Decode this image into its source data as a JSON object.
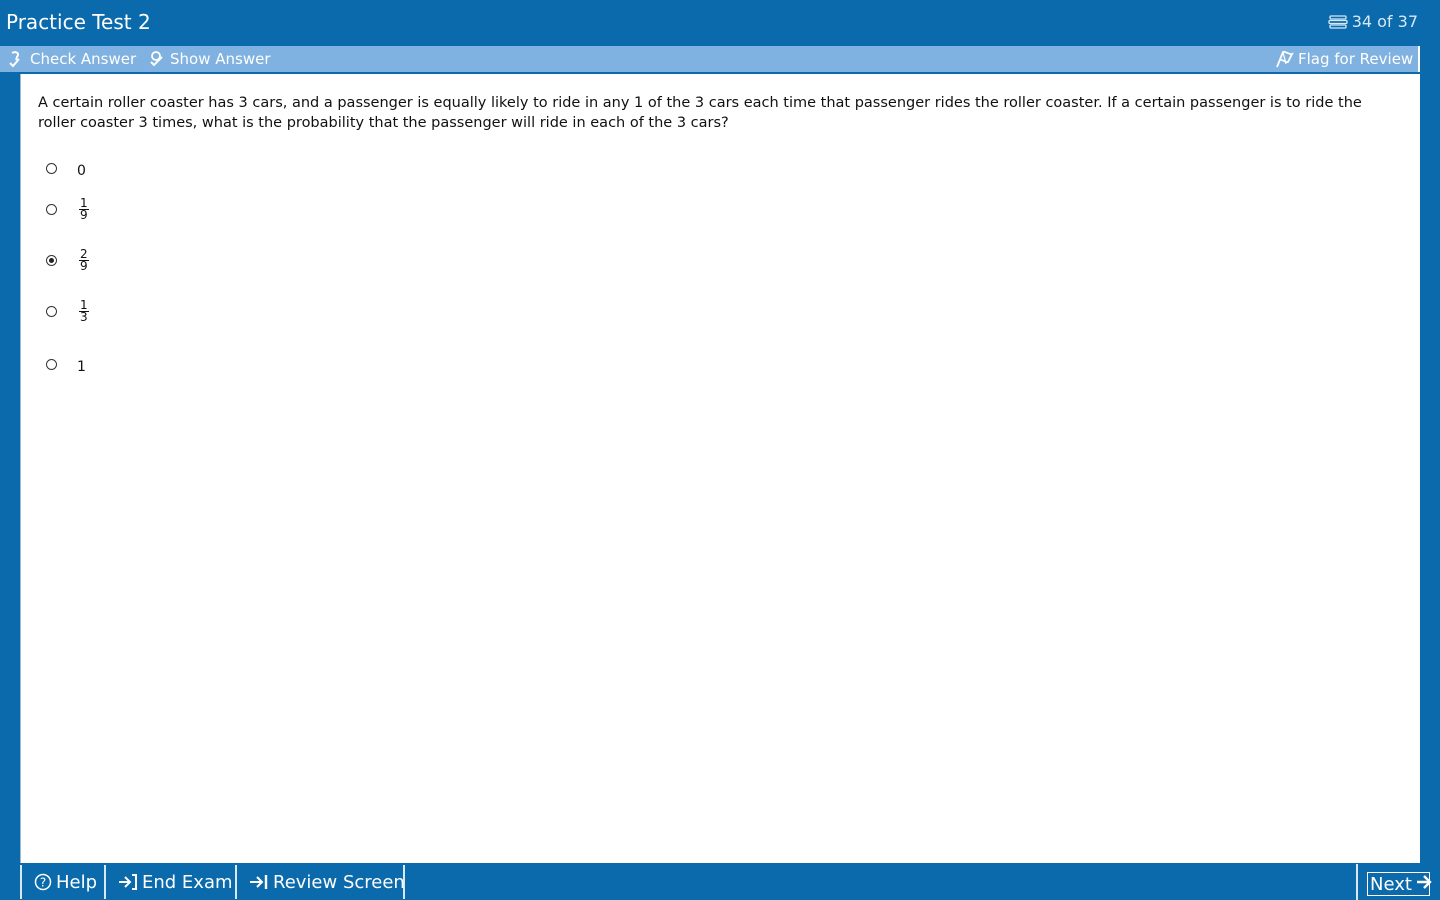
{
  "window": {
    "title": "Practice Test 2",
    "counter": "34 of 37"
  },
  "toolbar": {
    "check_answer": "Check Answer",
    "show_answer": "Show Answer",
    "flag_review": "Flag for Review"
  },
  "question": {
    "text": "A certain roller coaster has 3 cars, and a passenger is equally likely to ride in any 1 of the 3 cars each time that passenger rides the roller coaster.  If a certain passenger is to ride the roller coaster 3 times, what is the probability that the passenger will ride in each of the 3 cars?"
  },
  "choices": [
    {
      "value": "0",
      "selected": false
    },
    {
      "numerator": "1",
      "denominator": "9",
      "selected": false
    },
    {
      "numerator": "2",
      "denominator": "9",
      "selected": true
    },
    {
      "numerator": "1",
      "denominator": "3",
      "selected": false
    },
    {
      "value": "1",
      "selected": false
    }
  ],
  "bottom": {
    "help": "Help",
    "end_exam": "End Exam",
    "review_screen": "Review Screen",
    "next": "Next"
  },
  "colors": {
    "frame": "#0a6aab",
    "toolbar": "#7fb1e1",
    "content": "#ffffff"
  }
}
